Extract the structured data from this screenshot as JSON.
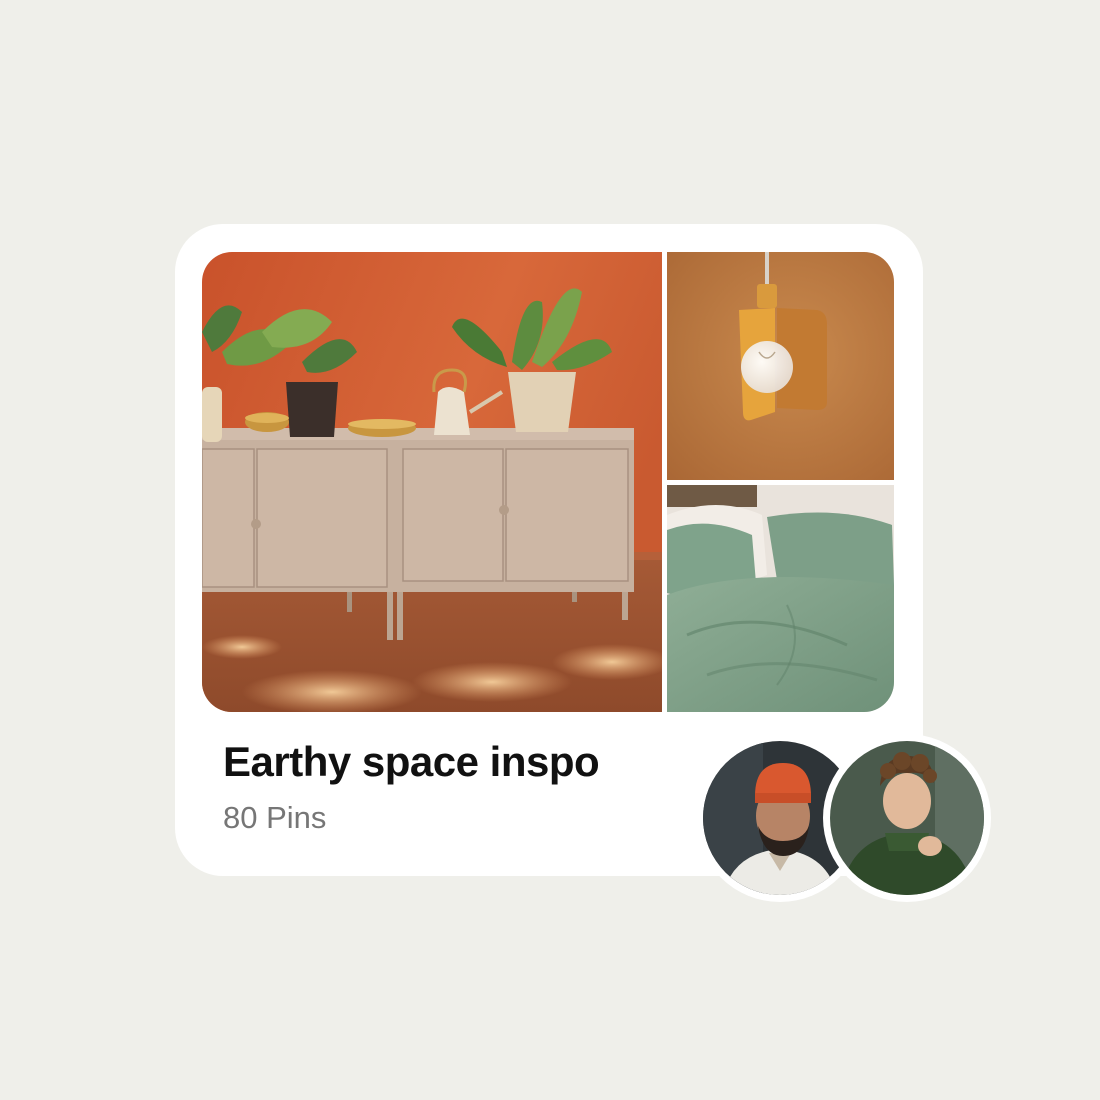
{
  "board": {
    "title": "Earthy space inspo",
    "pin_count": "80 Pins",
    "images": [
      {
        "name": "main-image",
        "subject": "beige cabinets with potted plants against terracotta wall"
      },
      {
        "name": "pendant-lamp-image",
        "subject": "mustard pendant lamp with bulb"
      },
      {
        "name": "bedding-image",
        "subject": "sage green linen bedding"
      }
    ],
    "collaborators": [
      {
        "name": "collaborator-avatar-1"
      },
      {
        "name": "collaborator-avatar-2"
      }
    ]
  },
  "colors": {
    "background": "#efefea",
    "card": "#ffffff",
    "title": "#111111",
    "subtitle": "#767676"
  }
}
